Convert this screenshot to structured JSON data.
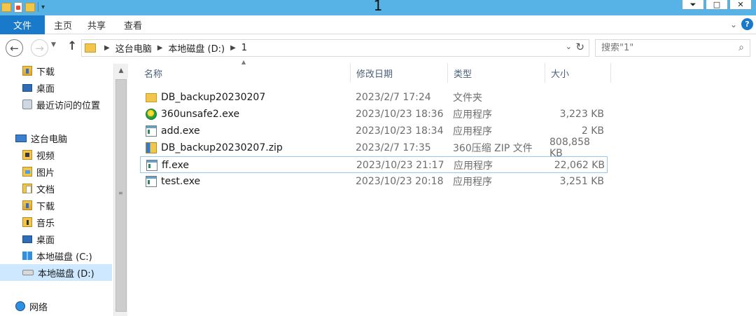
{
  "window": {
    "title": "1",
    "controls": [
      "⏷",
      "□",
      "✕"
    ]
  },
  "ribbon": {
    "file_tab": "文件",
    "tabs": [
      "主页",
      "共享",
      "查看"
    ],
    "help": "?"
  },
  "address": {
    "crumbs": [
      "这台电脑",
      "本地磁盘 (D:)",
      "1"
    ],
    "search_placeholder": "搜索\"1\""
  },
  "nav": {
    "items": [
      {
        "label": "下载",
        "icon": "download-folder-icon"
      },
      {
        "label": "桌面",
        "icon": "desktop-icon"
      },
      {
        "label": "最近访问的位置",
        "icon": "recent-places-icon"
      },
      {
        "label": "这台电脑",
        "icon": "this-pc-icon"
      },
      {
        "label": "视频",
        "icon": "videos-folder-icon"
      },
      {
        "label": "图片",
        "icon": "pictures-folder-icon"
      },
      {
        "label": "文档",
        "icon": "documents-folder-icon"
      },
      {
        "label": "下载",
        "icon": "download-folder-icon"
      },
      {
        "label": "音乐",
        "icon": "music-folder-icon"
      },
      {
        "label": "桌面",
        "icon": "desktop-folder-icon"
      },
      {
        "label": "本地磁盘 (C:)",
        "icon": "windows-drive-icon"
      },
      {
        "label": "本地磁盘 (D:)",
        "icon": "drive-icon"
      },
      {
        "label": "网络",
        "icon": "network-icon"
      }
    ]
  },
  "files": {
    "columns": [
      "名称",
      "修改日期",
      "类型",
      "大小"
    ],
    "rows": [
      {
        "name": "DB_backup20230207",
        "date": "2023/2/7 17:24",
        "type": "文件夹",
        "size": "",
        "icon": "folder-icon"
      },
      {
        "name": "360unsafe2.exe",
        "date": "2023/10/23 18:36",
        "type": "应用程序",
        "size": "3,223 KB",
        "icon": "360-app-icon"
      },
      {
        "name": "add.exe",
        "date": "2023/10/23 18:34",
        "type": "应用程序",
        "size": "2 KB",
        "icon": "exe-icon"
      },
      {
        "name": "DB_backup20230207.zip",
        "date": "2023/2/7 17:35",
        "type": "360压缩 ZIP 文件",
        "size": "808,858 KB",
        "icon": "zip-archive-icon"
      },
      {
        "name": "ff.exe",
        "date": "2023/10/23 21:17",
        "type": "应用程序",
        "size": "22,062 KB",
        "icon": "exe-icon"
      },
      {
        "name": "test.exe",
        "date": "2023/10/23 20:18",
        "type": "应用程序",
        "size": "3,251 KB",
        "icon": "exe-icon"
      }
    ]
  }
}
